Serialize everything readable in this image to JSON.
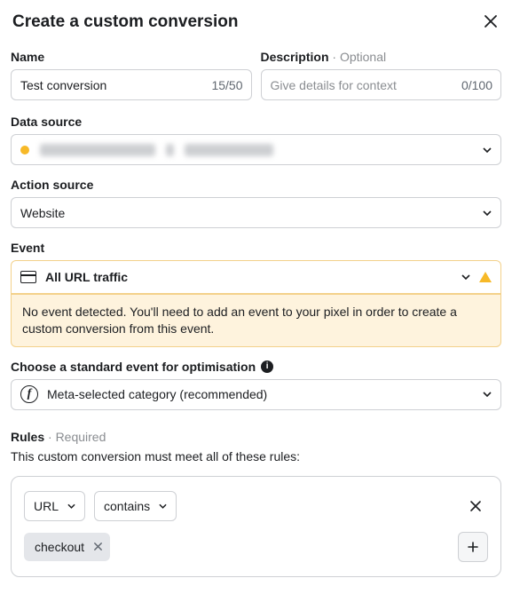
{
  "header": {
    "title": "Create a custom conversion"
  },
  "fields": {
    "name": {
      "label": "Name",
      "value": "Test conversion",
      "count": "15/50"
    },
    "description": {
      "label": "Description",
      "optional": "· Optional",
      "placeholder": "Give details for context",
      "count": "0/100",
      "value": ""
    }
  },
  "dataSource": {
    "label": "Data source"
  },
  "actionSource": {
    "label": "Action source",
    "value": "Website"
  },
  "event": {
    "label": "Event",
    "value": "All URL traffic",
    "warning": "No event detected. You'll need to add an event to your pixel in order to create a custom conversion from this event."
  },
  "optimisation": {
    "label": "Choose a standard event for optimisation",
    "value": "Meta-selected category (recommended)"
  },
  "rules": {
    "label": "Rules",
    "required": "· Required",
    "subtitle": "This custom conversion must meet all of these rules:",
    "field": "URL",
    "operator": "contains",
    "tags": [
      "checkout"
    ]
  }
}
